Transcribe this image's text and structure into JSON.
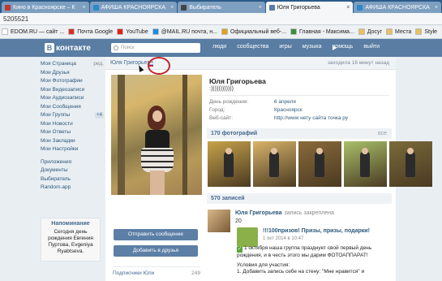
{
  "browser": {
    "tabs": [
      {
        "label": "Кино в Красноярске – К",
        "color": "#c0392b",
        "active": false
      },
      {
        "label": "АФИША КРАСНОЯРСКА",
        "color": "#2d89c8",
        "active": false
      },
      {
        "label": "Выбиратель",
        "color": "#444444",
        "active": false
      },
      {
        "label": "Юля Григорьева",
        "color": "#597da3",
        "active": true
      },
      {
        "label": "АФИША КРАСНОЯРСКА",
        "color": "#2d89c8",
        "active": false
      }
    ],
    "tab_close": "×",
    "url_fragment": "5205521",
    "bookmarks": [
      {
        "label": "EDOM.RU — сайт ...",
        "color": "#ffffff"
      },
      {
        "label": "Почта Google",
        "color": "#d93025"
      },
      {
        "label": "YouTube",
        "color": "#e62117"
      },
      {
        "label": "@MAIL.RU почта, н...",
        "color": "#168de2"
      },
      {
        "label": "Официальный веб-...",
        "color": "#e0a020"
      },
      {
        "label": "Главная - Максима...",
        "color": "#3c8f3c"
      },
      {
        "label": "Досуг",
        "color": "#e8c15a"
      },
      {
        "label": "Места",
        "color": "#e8c15a"
      },
      {
        "label": "Style",
        "color": "#e8c15a"
      }
    ]
  },
  "vk": {
    "logo_letter": "В",
    "logo_text": "контакте",
    "search_placeholder": "Поиск",
    "nav": [
      "люди",
      "сообщества",
      "игры",
      "музыка",
      "помощь",
      "выйти"
    ],
    "menu": [
      {
        "label": "Моя Страница",
        "aux": "ред."
      },
      {
        "label": "Мои Друзья"
      },
      {
        "label": "Мои Фотографии"
      },
      {
        "label": "Мои Видеозаписи"
      },
      {
        "label": "Мои Аудиозаписи"
      },
      {
        "label": "Мои Сообщения"
      },
      {
        "label": "Мои Группы",
        "count": "+4"
      },
      {
        "label": "Мои Новости"
      },
      {
        "label": "Мои Ответы"
      },
      {
        "label": "Мои Закладки"
      },
      {
        "label": "Мои Настройки"
      }
    ],
    "menu_extra": [
      "Приложения",
      "Документы",
      "Выбиратель",
      "Random.app"
    ],
    "reminder": {
      "title": "Напоминание",
      "text": "Сегодня день рождения Евгения Пуртова, Evgeniya Ryabtseva."
    }
  },
  "profile": {
    "header_name": "Юля Григорьева",
    "last_seen": "заходила 16 минут назад",
    "name": "Юля Григорьева",
    "status": ":))))))))))))",
    "info": [
      {
        "key": "День рождения:",
        "value": "6 апреля"
      },
      {
        "key": "Город:",
        "value": "Красноярск"
      },
      {
        "key": "Веб-сайт:",
        "value": "http://www нету сайта точка ру"
      }
    ],
    "send_message": "Отправить сообщение",
    "add_friend": "Добавить в друзья",
    "subscribers_label": "Подписчики Юли",
    "subscribers_count": "249",
    "photos_header": "170 фотографий",
    "photos_all": "все",
    "photo_colors": [
      "#c7a24a",
      "#d9b46a",
      "#8a6a3a",
      "#a9c06a",
      "#7a6a3a"
    ],
    "posts_header": "570 записей"
  },
  "post": {
    "author": "Юля Григорьева",
    "pinned": "запись закреплена",
    "number": "20",
    "repost_title": "!!!100призов! Призы, призы, подарки!",
    "repost_date": "1 окт 2014 в 10:47",
    "text_line1": "1 октября наша группа празднует свой первый день рождения, и в честь этого мы дарим ФОТОАППАРАТ!",
    "text_line2": "Условия для участия:",
    "text_line3": "1. Добавить запись себе на стену: \"Мне нравится\" и"
  }
}
